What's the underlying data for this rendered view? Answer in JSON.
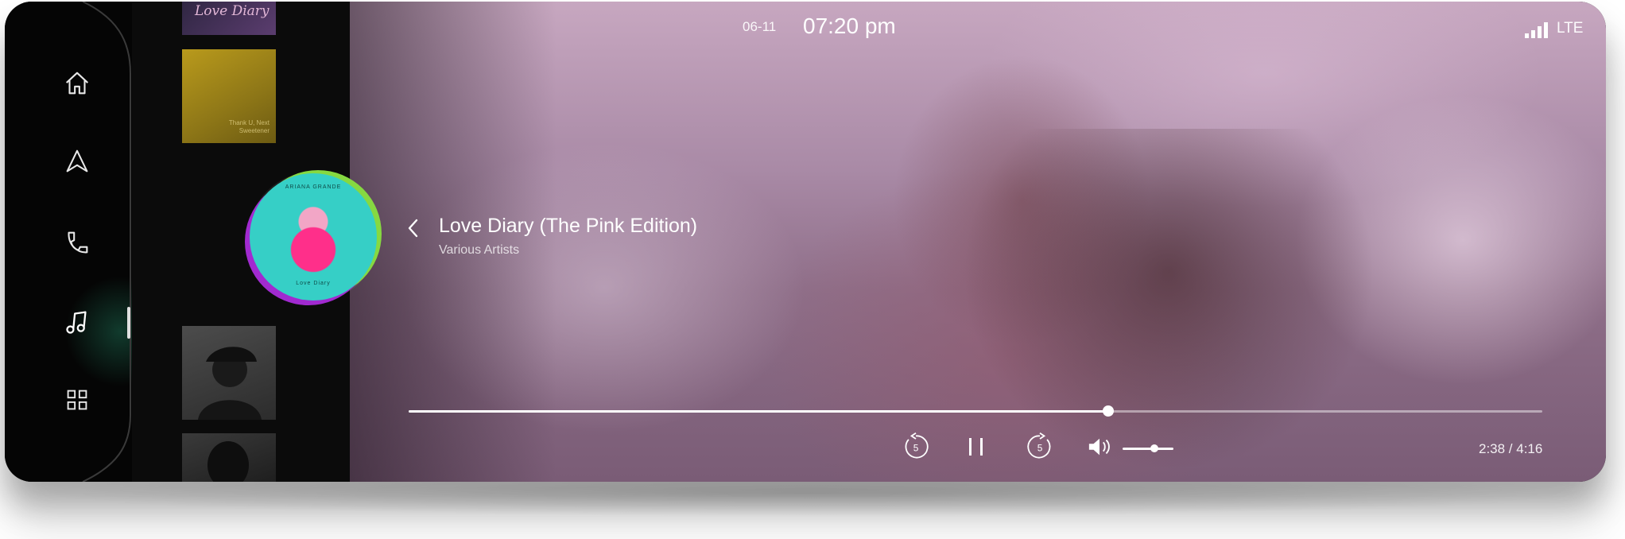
{
  "status": {
    "date": "06-11",
    "time": "07:20 pm",
    "network": "LTE"
  },
  "nav": {
    "items": [
      {
        "icon": "home-icon"
      },
      {
        "icon": "navigation-icon"
      },
      {
        "icon": "phone-icon"
      },
      {
        "icon": "music-icon",
        "active": true
      },
      {
        "icon": "apps-grid-icon"
      }
    ]
  },
  "albums": {
    "top_cover_text": "Love Diary",
    "second_cover_text": "Thank U, Next Sweetener",
    "current_cover_caption_top": "ARIANA GRANDE",
    "current_cover_caption_bottom": "Love Diary"
  },
  "track": {
    "title": "Love Diary (The Pink Edition)",
    "artist": "Various Artists"
  },
  "playback": {
    "elapsed": "2:38",
    "duration": "4:16",
    "time_display": "2:38 / 4:16",
    "progress": 0.6172,
    "volume": 0.62,
    "skip_seconds": "5",
    "state": "playing"
  },
  "colors": {
    "accent": "#ffffff",
    "background": "#000000",
    "nav_active_glow": "#28a078"
  }
}
